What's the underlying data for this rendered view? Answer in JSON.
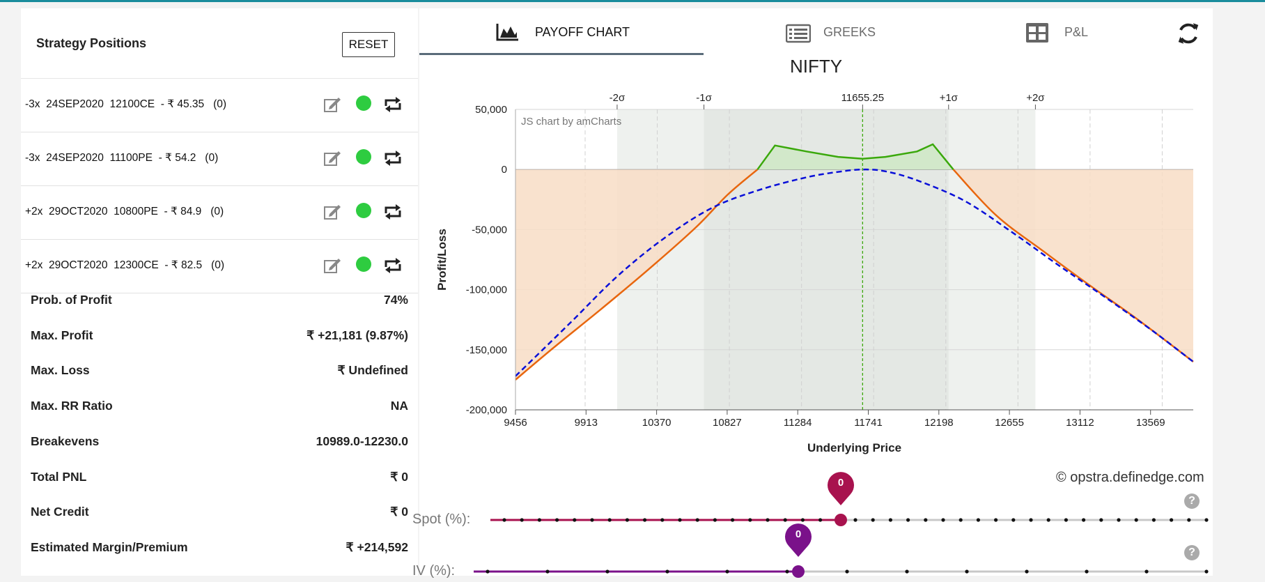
{
  "strategy": {
    "title": "Strategy Positions",
    "reset_label": "RESET",
    "positions": [
      {
        "label": "-3x  24SEP2020  12100CE  - ₹ 45.35   (0)"
      },
      {
        "label": "-3x  24SEP2020  11100PE  - ₹ 54.2   (0)"
      },
      {
        "label": "+2x  29OCT2020  10800PE  - ₹ 84.9   (0)"
      },
      {
        "label": "+2x  29OCT2020  12300CE  - ₹ 82.5   (0)"
      }
    ],
    "position_icons": {
      "edit": "edit-icon",
      "status": "status-dot-green",
      "swap": "swap-icon"
    }
  },
  "stats": [
    {
      "label": "Prob. of Profit",
      "value": "74%"
    },
    {
      "label": "Max. Profit",
      "value": "₹ +21,181 (9.87%)"
    },
    {
      "label": "Max. Loss",
      "value": "₹ Undefined"
    },
    {
      "label": "Max. RR Ratio",
      "value": "NA"
    },
    {
      "label": "Breakevens",
      "value": "10989.0-12230.0"
    },
    {
      "label": "Total PNL",
      "value": "₹ 0"
    },
    {
      "label": "Net Credit",
      "value": "₹ 0"
    },
    {
      "label": "Estimated Margin/Premium",
      "value": "₹ +214,592"
    }
  ],
  "tabs": [
    {
      "label": "PAYOFF CHART",
      "icon": "area-chart-icon",
      "active": true
    },
    {
      "label": "GREEKS",
      "icon": "list-icon",
      "active": false
    },
    {
      "label": "P&L",
      "icon": "table-icon",
      "active": false
    }
  ],
  "refresh_icon": "refresh-icon",
  "chart_data": {
    "type": "line",
    "title": "NIFTY",
    "xlabel": "Underlying Price",
    "ylabel": "Profit/Loss",
    "credit": "JS chart by amCharts",
    "x_ticks": [
      "9456",
      "9913",
      "10370",
      "10827",
      "11284",
      "11741",
      "12198",
      "12655",
      "13112",
      "13569"
    ],
    "y_ticks": [
      "50,000",
      "0",
      "-50,000",
      "-100,000",
      "-150,000",
      "-200,000"
    ],
    "xlim": [
      9456,
      13750
    ],
    "ylim": [
      -200000,
      50000
    ],
    "spot": 11655.25,
    "sigma_labels": [
      "-2σ",
      "-1σ",
      "11655.25",
      "+1σ",
      "+2σ"
    ],
    "sigma_x": [
      10100,
      10650,
      11655.25,
      12200,
      12750
    ],
    "band_1sigma": [
      10650,
      12200
    ],
    "band_2sigma": [
      10100,
      12750
    ],
    "grid": true,
    "colors": {
      "expiry_profit": "#3aa80b",
      "expiry_loss": "#e8660e",
      "target": "#0a10d8",
      "loss_fill": "#f8ddc6",
      "profit_fill": "#cfe8c6",
      "band": "#e4e8e4",
      "spot_line": "#3aa80b"
    },
    "series": [
      {
        "x": [
          9456,
          9700,
          10000,
          10300,
          10600,
          10800,
          10989,
          11100,
          11300,
          11500,
          11655,
          11800,
          12000,
          12100,
          12230,
          12500,
          12800,
          13100,
          13400,
          13750
        ],
        "values": [
          -175000,
          -148000,
          -116000,
          -83000,
          -48000,
          -21000,
          0,
          20000,
          15000,
          10500,
          9000,
          10500,
          15000,
          21000,
          0,
          -38000,
          -68000,
          -97000,
          -125000,
          -160000
        ]
      },
      {
        "x": [
          9456,
          9800,
          10100,
          10400,
          10700,
          11000,
          11300,
          11500,
          11655,
          11800,
          12000,
          12300,
          12600,
          12900,
          13200,
          13500,
          13750
        ],
        "values": [
          -172000,
          -128000,
          -89000,
          -57000,
          -32000,
          -17000,
          -6500,
          -2000,
          0,
          -1500,
          -9000,
          -26000,
          -52000,
          -80000,
          -107000,
          -135000,
          -160000
        ]
      }
    ]
  },
  "watermark": "© opstra.definedge.com",
  "sliders": [
    {
      "label": "Spot (%):",
      "value": "0",
      "level": 0.5,
      "color": "#a8124e"
    },
    {
      "label": "IV (%):",
      "value": "0",
      "level": 0.5,
      "color": "#7a118a"
    }
  ],
  "help_glyph": "?"
}
